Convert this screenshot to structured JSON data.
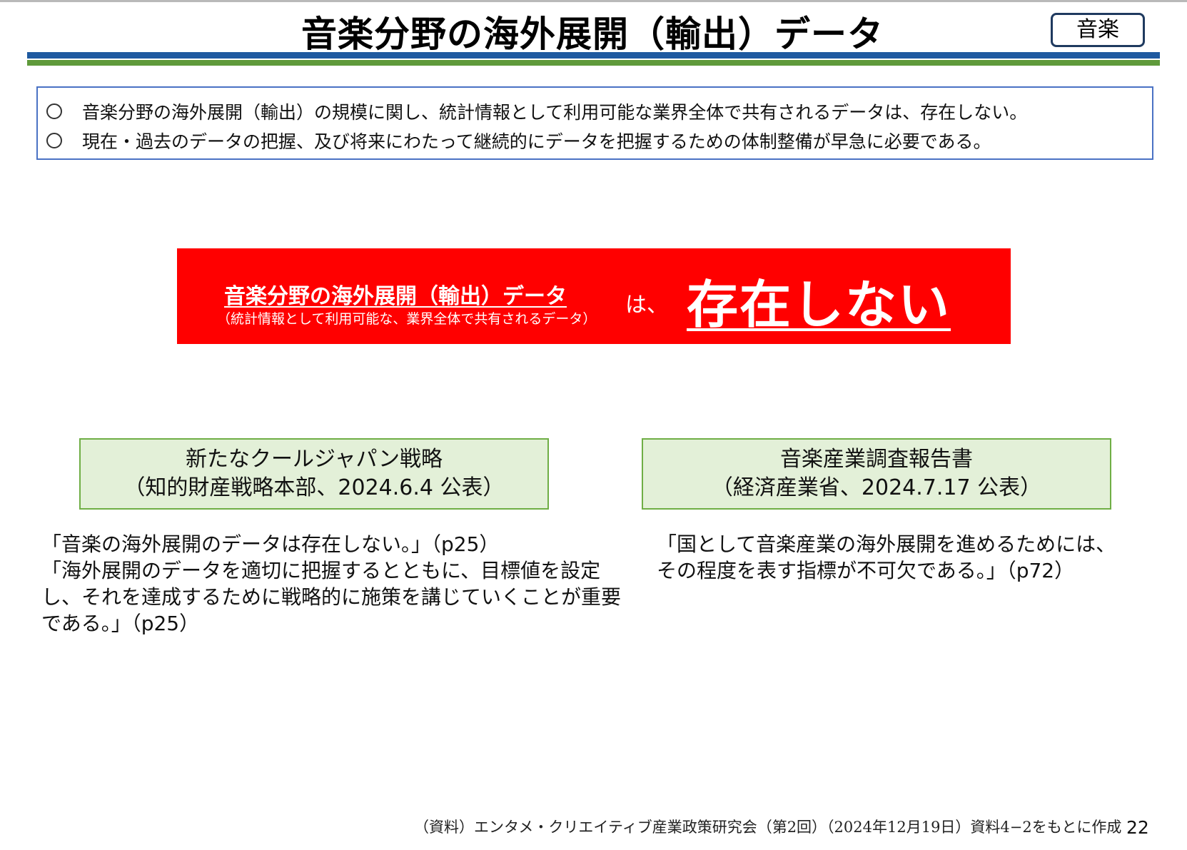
{
  "header": {
    "title": "音楽分野の海外展開（輸出）データ",
    "badge": "音楽"
  },
  "summary": {
    "lines": [
      "音楽分野の海外展開（輸出）の規模に関し、統計情報として利用可能な業界全体で共有されるデータは、存在しない。",
      "現在・過去のデータの把握、及び将来にわたって継続的にデータを把握するための体制整備が早急に必要である。"
    ]
  },
  "banner": {
    "main": "音楽分野の海外展開（輸出）データ",
    "sub": "（統計情報として利用可能な、業界全体で共有されるデータ）",
    "particle": "は、",
    "emphasis": "存在しない"
  },
  "sources": [
    {
      "title": "新たなクールジャパン戦略",
      "subtitle": "（知的財産戦略本部、2024.6.4 公表）",
      "quote_lines": [
        "「音楽の海外展開のデータは存在しない。」（p25）",
        "「海外展開のデータを適切に把握するとともに、目標値を設定",
        "し、それを達成するために戦略的に施策を講じていくことが重要",
        "である。」（p25）"
      ]
    },
    {
      "title": "音楽産業調査報告書",
      "subtitle": "（経済産業省、2024.7.17 公表）",
      "quote_lines": [
        "「国として音楽産業の海外展開を進めるためには、",
        "その程度を表す指標が不可欠である。」（p72）"
      ]
    }
  ],
  "footer": {
    "note": "（資料）エンタメ・クリエイティブ産業政策研究会（第2回）（2024年12月19日）資料4−2をもとに作成",
    "page": "22"
  },
  "colors": {
    "banner_red": "#ff0000",
    "rule_blue": "#1f5aa0",
    "rule_green": "#5f9a3b",
    "summary_border": "#4a72c4",
    "source_fill": "#e3f0d8",
    "source_border": "#6fae45"
  }
}
